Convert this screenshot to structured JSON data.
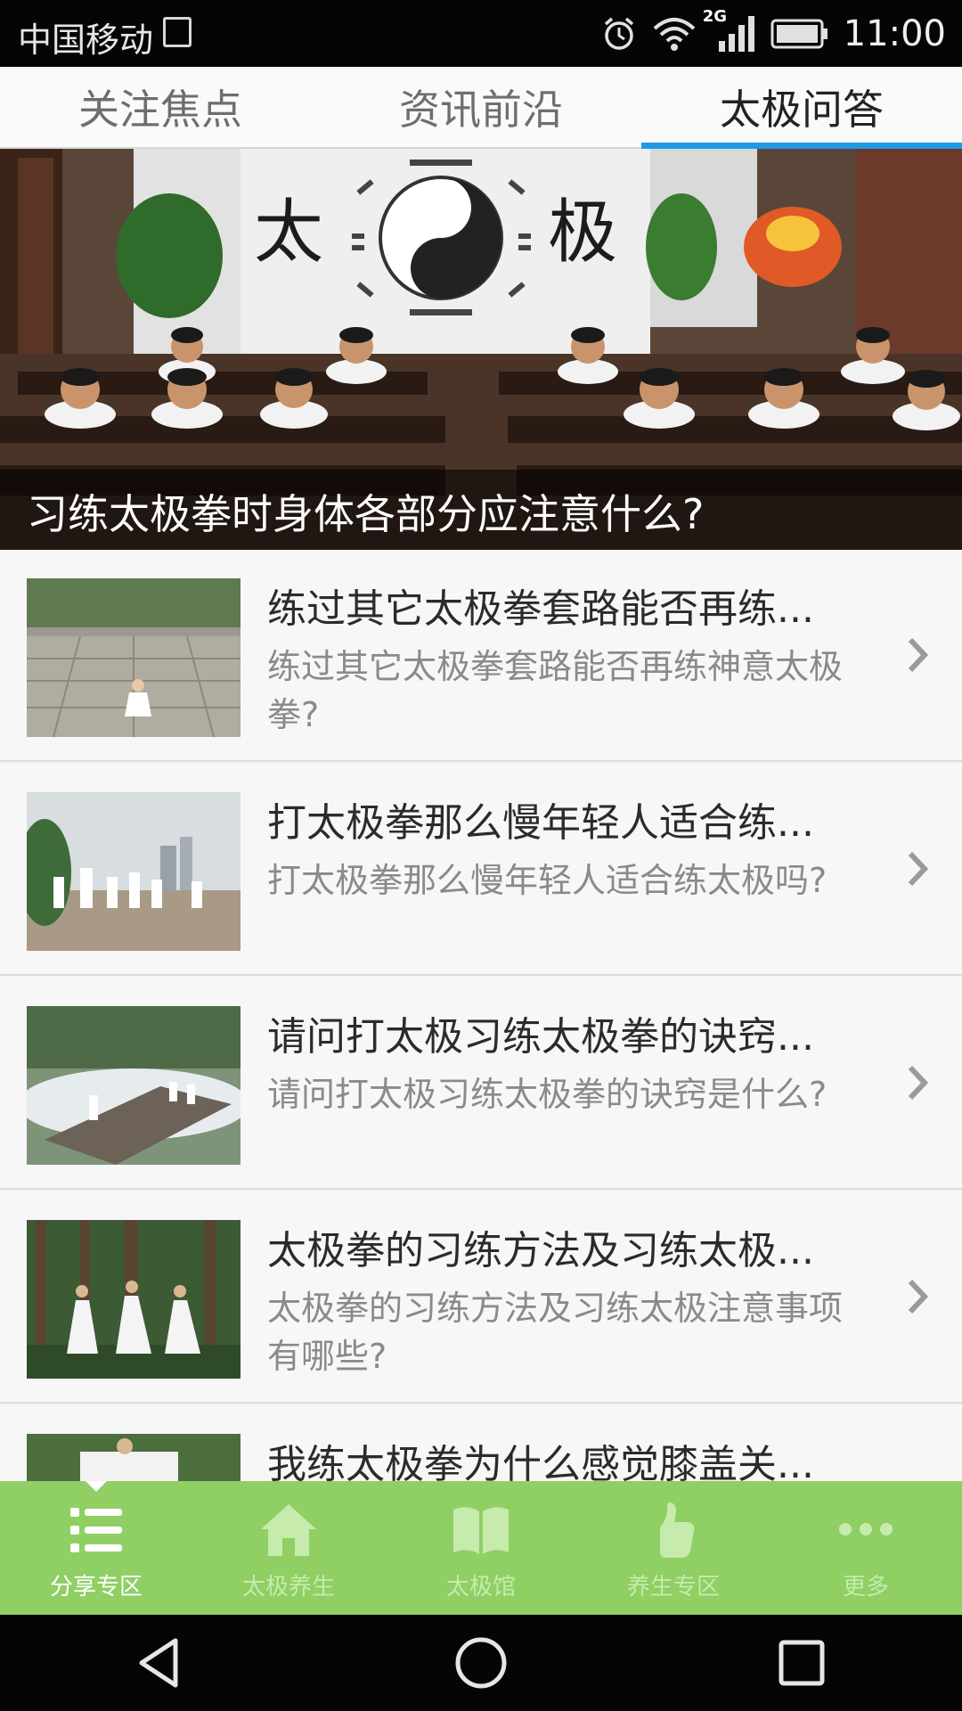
{
  "status_bar": {
    "carrier": "中国移动",
    "network": "2G",
    "time": "11:00"
  },
  "tabs": [
    {
      "label": "关注焦点",
      "active": false
    },
    {
      "label": "资讯前沿",
      "active": false
    },
    {
      "label": "太极问答",
      "active": true
    }
  ],
  "banner": {
    "caption": "习练太极拳时身体各部分应注意什么?",
    "banner_text_left": "太",
    "banner_text_right": "极"
  },
  "articles": [
    {
      "title": "练过其它太极拳套路能否再练...",
      "desc": "练过其它太极拳套路能否再练神意太极拳?"
    },
    {
      "title": "打太极拳那么慢年轻人适合练...",
      "desc": "打太极拳那么慢年轻人适合练太极吗?"
    },
    {
      "title": "请问打太极习练太极拳的诀窍...",
      "desc": "请问打太极习练太极拳的诀窍是什么?"
    },
    {
      "title": "太极拳的习练方法及习练太极...",
      "desc": "太极拳的习练方法及习练太极注意事项有哪些?"
    },
    {
      "title": "我练太极拳为什么感觉膝盖关...",
      "desc": ""
    }
  ],
  "bottom_nav": [
    {
      "label": "分享专区",
      "icon": "list-icon",
      "active": true
    },
    {
      "label": "太极养生",
      "icon": "home-icon",
      "active": false
    },
    {
      "label": "太极馆",
      "icon": "book-icon",
      "active": false
    },
    {
      "label": "养生专区",
      "icon": "thumbs-up-icon",
      "active": false
    },
    {
      "label": "更多",
      "icon": "more-icon",
      "active": false
    }
  ],
  "colors": {
    "accent": "#1e9ae6",
    "nav_bg": "#8fcf64"
  }
}
